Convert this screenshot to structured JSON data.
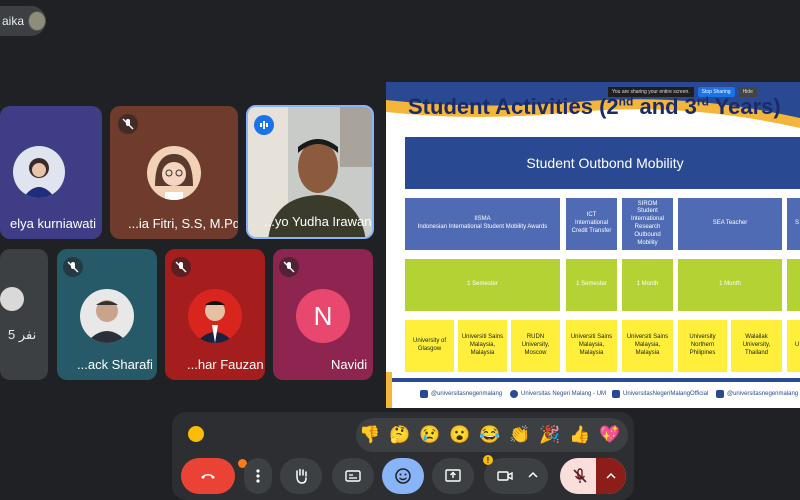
{
  "presenter": {
    "name": "aika"
  },
  "tiles": [
    {
      "name": "elya kurniawati"
    },
    {
      "name": "...ia Fitri, S.S, M.Pd"
    },
    {
      "name": "...yo Yudha Irawan"
    },
    {
      "name": "5 نفر"
    },
    {
      "name": "...ack Sharafi"
    },
    {
      "name": "...har Fauzan"
    },
    {
      "name": "Navidi",
      "initial": "N"
    }
  ],
  "share_bar": {
    "text": "You are sharing your entire screen.",
    "stop": "Stop Sharing",
    "hide": "Hide"
  },
  "slide": {
    "title_main": "Student Activities (2",
    "sup1": "nd",
    "and": " and 3",
    "sup2": "rd",
    "tail": " Years)",
    "banner": "Student Outbond Mobility",
    "programs": [
      "IISMA\nIndonesian International Student Mobility Awards",
      "ICT\nInternational Credit Transfer",
      "SIROM\nStudent International Research Outbound Mobility",
      "SEA Teacher",
      "S"
    ],
    "durations": [
      "1 Semester",
      "1 Semester",
      "1 Month",
      "1 Month",
      ""
    ],
    "universities": [
      "University of Glasgow",
      "Universiti Sains Malaysia, Malaysia",
      "RUDN University, Moscow",
      "Universiti Sains Malaysia, Malaysia",
      "Universiti Sains Malaysia, Malaysia",
      "University Northern Philipines",
      "Walailak University, Thailand",
      "U"
    ],
    "social": [
      "@universitasnegerimalang",
      "Universitas Negeri Malang - UM",
      "UniversitasNegeriMalangOfficial",
      "@universitasnegerimalang"
    ]
  },
  "reactions": [
    "👎",
    "🤔",
    "😢",
    "😮",
    "😂",
    "👏",
    "🎉",
    "👍",
    "💖"
  ],
  "colors": {
    "end_call": "#ea4335",
    "active": "#8ab4f8",
    "mic_off_bg": "#f9dedc",
    "accent": "#fbbc04"
  }
}
